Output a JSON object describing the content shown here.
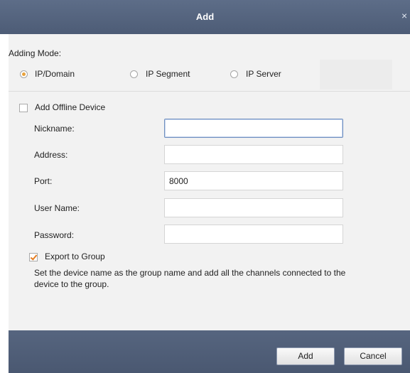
{
  "dialog": {
    "title": "Add",
    "close_glyph": "×"
  },
  "adding_mode": {
    "label": "Adding Mode:",
    "options": [
      {
        "label": "IP/Domain",
        "selected": true
      },
      {
        "label": "IP Segment",
        "selected": false
      },
      {
        "label": "IP Server",
        "selected": false
      }
    ]
  },
  "offline": {
    "label": "Add Offline Device",
    "checked": false
  },
  "form": {
    "nickname": {
      "label": "Nickname:",
      "value": ""
    },
    "address": {
      "label": "Address:",
      "value": ""
    },
    "port": {
      "label": "Port:",
      "value": "8000"
    },
    "username": {
      "label": "User Name:",
      "value": ""
    },
    "password": {
      "label": "Password:",
      "value": ""
    }
  },
  "export_group": {
    "label": "Export to Group",
    "checked": true,
    "description": "Set the device name as the group name and add all the channels connected to the device to the group."
  },
  "buttons": {
    "add": "Add",
    "cancel": "Cancel"
  },
  "colors": {
    "titlebar": "#56657f",
    "accent_check": "#e67e22",
    "radio_selected": "#e8a23d",
    "panel": "#f2f2f2"
  }
}
